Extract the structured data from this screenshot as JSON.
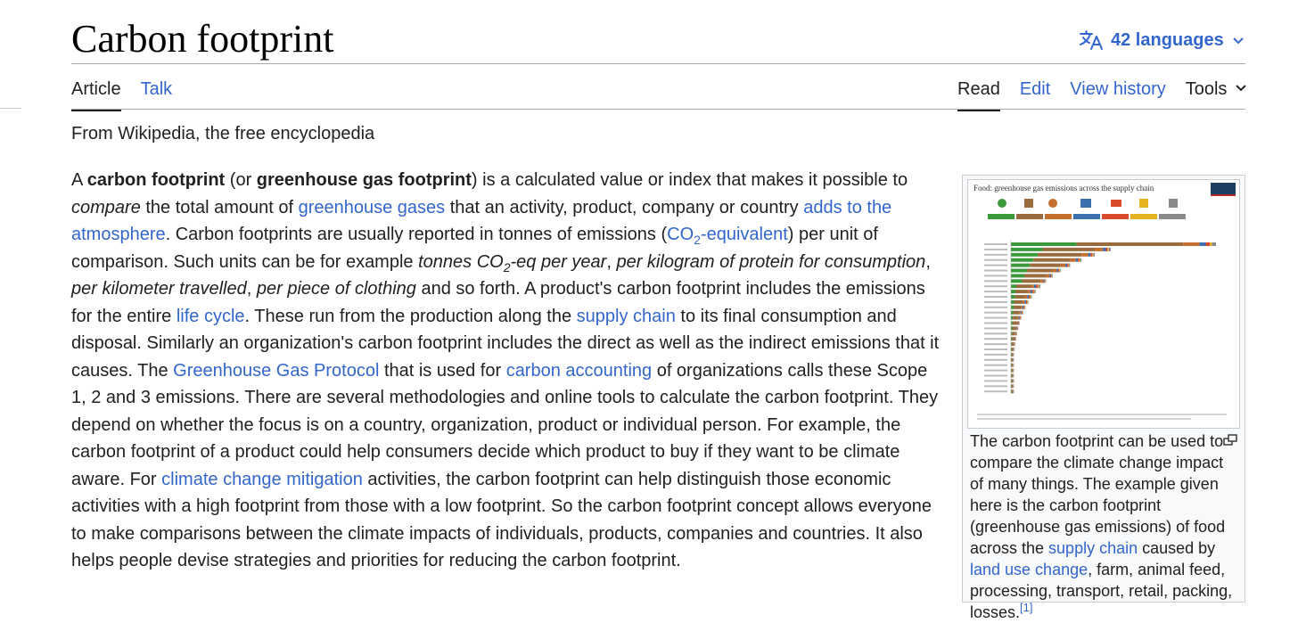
{
  "article": {
    "title": "Carbon footprint",
    "languages_label": "42 languages",
    "tagline": "From Wikipedia, the free encyclopedia"
  },
  "tabs": {
    "article": "Article",
    "talk": "Talk",
    "read": "Read",
    "edit": "Edit",
    "view_history": "View history",
    "tools": "Tools"
  },
  "body": {
    "t1": "A ",
    "b1": "carbon footprint",
    "t2": " (or ",
    "b2": "greenhouse gas footprint",
    "t3": ") is a calculated value or index that makes it possible to ",
    "i1": "compare",
    "t4": " the total amount of ",
    "l1": "greenhouse gases",
    "t5": " that an activity, product, company or country ",
    "l2": "adds to the atmosphere",
    "t6": ". Carbon footprints are usually reported in tonnes of emissions (",
    "l3a": "CO",
    "l3sub": "2",
    "l3b": "-equivalent",
    "t7": ") per unit of comparison. Such units can be for example ",
    "i2a": "tonnes CO",
    "i2sub": "2",
    "i2b": "-eq per year",
    "t8": ", ",
    "i3": "per kilogram of protein for consumption",
    "t9": ", ",
    "i4": "per kilometer travelled",
    "t10": ", ",
    "i5": "per piece of clothing",
    "t11": " and so forth. A product's carbon footprint includes the emissions for the entire ",
    "l4": "life cycle",
    "t12": ". These run from the production along the ",
    "l5": "supply chain",
    "t13": " to its final consumption and disposal. Similarly an organization's carbon footprint includes the direct as well as the indirect emissions that it causes. The ",
    "l6": "Greenhouse Gas Protocol",
    "t14": " that is used for ",
    "l7": "carbon accounting",
    "t15": " of organizations calls these Scope 1, 2 and 3 emissions. There are several methodologies and online tools to calculate the carbon footprint. They depend on whether the focus is on a country, organization, product or individual person. For example, the carbon footprint of a product could help consumers decide which product to buy if they want to be climate aware. For ",
    "l8": "climate change mitigation",
    "t16": " activities, the carbon footprint can help distinguish those economic activities with a high footprint from those with a low footprint. So the carbon footprint concept allows everyone to make comparisons between the climate impacts of individuals, products, companies and countries. It also helps people devise strategies and priorities for reducing the carbon footprint."
  },
  "infobox": {
    "image_title": "Food: greenhouse gas emissions across the supply chain",
    "image_logo": "Our World in Data",
    "caption_t1": "The carbon footprint can be used to compare the climate change impact of many things. The example given here is the carbon footprint (greenhouse gas emissions) of food across the ",
    "caption_l1": "supply chain",
    "caption_t2": " caused by ",
    "caption_l2": "land use change",
    "caption_t3": ", farm, animal feed, processing, transport, retail, packing, losses.",
    "caption_ref": "[1]"
  },
  "colors": {
    "link": "#3366cc",
    "text": "#202122",
    "rule": "#a2a9b1",
    "infobox_bg": "#f8f9fa"
  },
  "icons": {
    "language": "translate-icon",
    "chevron": "chevron-down-icon",
    "enlarge": "enlarge-icon"
  }
}
